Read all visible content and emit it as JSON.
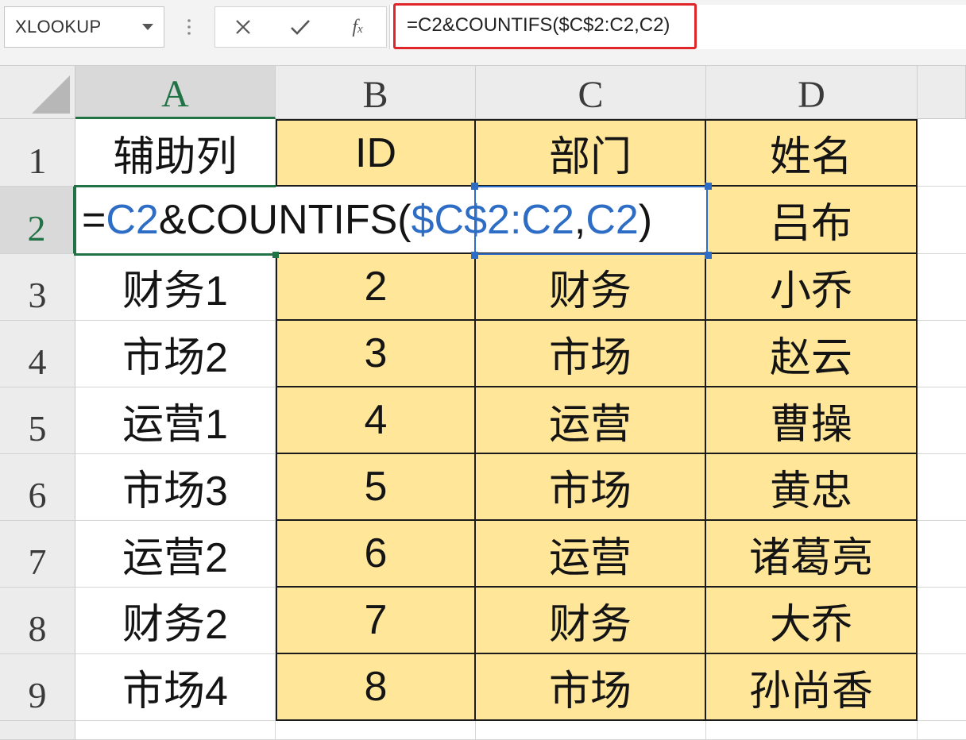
{
  "name_box": {
    "value": "XLOOKUP",
    "dropdown_icon": "chevron-down-icon"
  },
  "separator_icon": "more-vertical-icon",
  "formula_bar": {
    "cancel_icon": "close-icon",
    "enter_icon": "check-icon",
    "insert_function_label": "fx",
    "value": "=C2&COUNTIFS($C$2:C2,C2)"
  },
  "colors": {
    "table_fill": "#FFE699",
    "reference_blue": "#2E6DC5",
    "active_cell_green": "#217346",
    "callout_red": "#E0262A"
  },
  "grid": {
    "columns": [
      "A",
      "B",
      "C",
      "D"
    ],
    "row_numbers": [
      "1",
      "2",
      "3",
      "4",
      "5",
      "6",
      "7",
      "8",
      "9"
    ],
    "rows": [
      {
        "A": "辅助列",
        "B": "ID",
        "C": "部门",
        "D": "姓名"
      },
      {
        "D": "吕布"
      },
      {
        "A": "财务1",
        "B": "2",
        "C": "财务",
        "D": "小乔"
      },
      {
        "A": "市场2",
        "B": "3",
        "C": "市场",
        "D": "赵云"
      },
      {
        "A": "运营1",
        "B": "4",
        "C": "运营",
        "D": "曹操"
      },
      {
        "A": "市场3",
        "B": "5",
        "C": "市场",
        "D": "黄忠"
      },
      {
        "A": "运营2",
        "B": "6",
        "C": "运营",
        "D": "诸葛亮"
      },
      {
        "A": "财务2",
        "B": "7",
        "C": "财务",
        "D": "大乔"
      },
      {
        "A": "市场4",
        "B": "8",
        "C": "市场",
        "D": "孙尚香"
      }
    ]
  },
  "edit": {
    "segments": [
      "=",
      "C2",
      "&COUNTIFS(",
      "$C$2:C2",
      ",",
      "C2",
      ")"
    ]
  }
}
